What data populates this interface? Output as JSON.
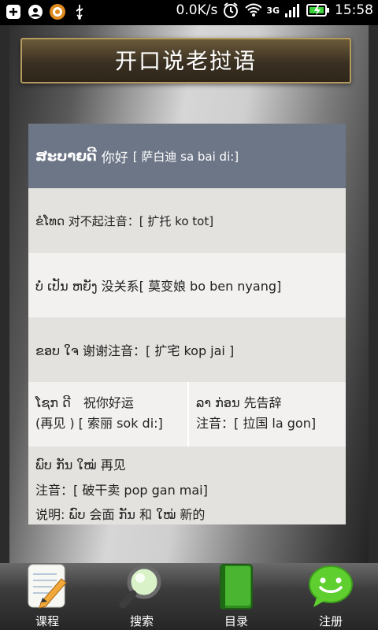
{
  "status_bar": {
    "speed": "0.0K/s",
    "network": "3G",
    "time": "15:58"
  },
  "header": {
    "title": "开口说老挝语"
  },
  "phrases": {
    "r1": {
      "lao": "ສະບາຍດີ",
      "cn": "你好",
      "pron": "[ 萨白迪 sa bai di:]"
    },
    "r2": {
      "text": "ຂໍໂທດ 对不起注音：[ 扩托 ko tot]"
    },
    "r3": {
      "text": "ບໍ່ ເປັນ ຫຍັງ 没关系[ 莫变娘 bo ben nyang]"
    },
    "r4": {
      "text": "ຂອບ ໃຈ 谢谢注音：[ 扩宅 kop jai ]"
    },
    "r5": {
      "left_line1": "ໂຊກ ດີ　祝你好运",
      "left_line2": "(再见 ) [ 索丽  sok di:]",
      "right_line1": "ລາ ກ່ອນ 先告辞",
      "right_line2": "注音：[ 拉国  la gon]"
    },
    "r6": {
      "line1": "ພົບ ກັນ ໃໝ່ 再见",
      "line2": "注音：[ 破干卖  pop gan mai]",
      "line3": "说明: ພົບ 会面  ກັນ 和  ໃໝ່ 新的"
    }
  },
  "nav": {
    "course": "课程",
    "search": "搜索",
    "catalog": "目录",
    "register": "注册"
  }
}
